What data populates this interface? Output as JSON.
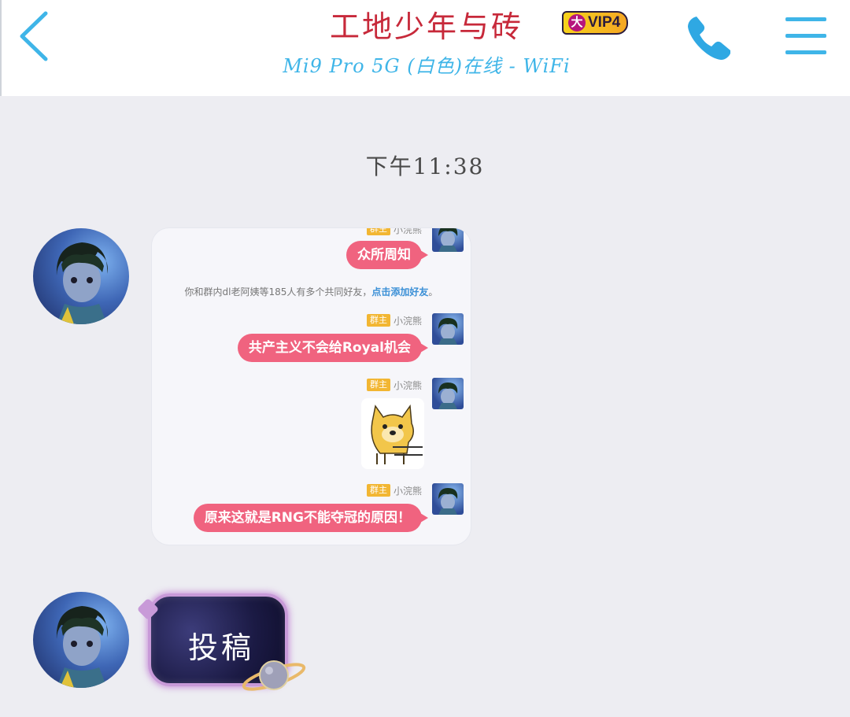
{
  "header": {
    "title": "工地少年与砖",
    "vip_badge": "VIP4",
    "vip_prefix": "大",
    "subtitle": "Mi9 Pro 5G (白色)在线 - WiFi"
  },
  "icons": {
    "back": "chevron-left-icon",
    "call": "phone-icon",
    "menu": "hamburger-menu-icon"
  },
  "colors": {
    "accent": "#3fb5e8",
    "title": "#c7293a",
    "bubble_pink": "#f0637f",
    "role_badge": "#f2b632",
    "link": "#3a8fd6"
  },
  "messages": {
    "timestamp": "下午11:38",
    "forwarded": {
      "items": [
        {
          "text": "众所周知"
        },
        {
          "role": "群主",
          "sender": "小浣熊",
          "text": "共产主义不会给Royal机会"
        },
        {
          "role": "群主",
          "sender": "小浣熊",
          "sticker": "doge-sticker"
        },
        {
          "role": "群主",
          "sender": "小浣熊",
          "text": "原来这就是RNG不能夺冠的原因！"
        }
      ],
      "system_notice": "你和群内dl老阿姨等185人有多个共同好友，",
      "system_link": "点击添加好友",
      "system_suffix": "。"
    },
    "special_bubble_text": "投稿"
  }
}
